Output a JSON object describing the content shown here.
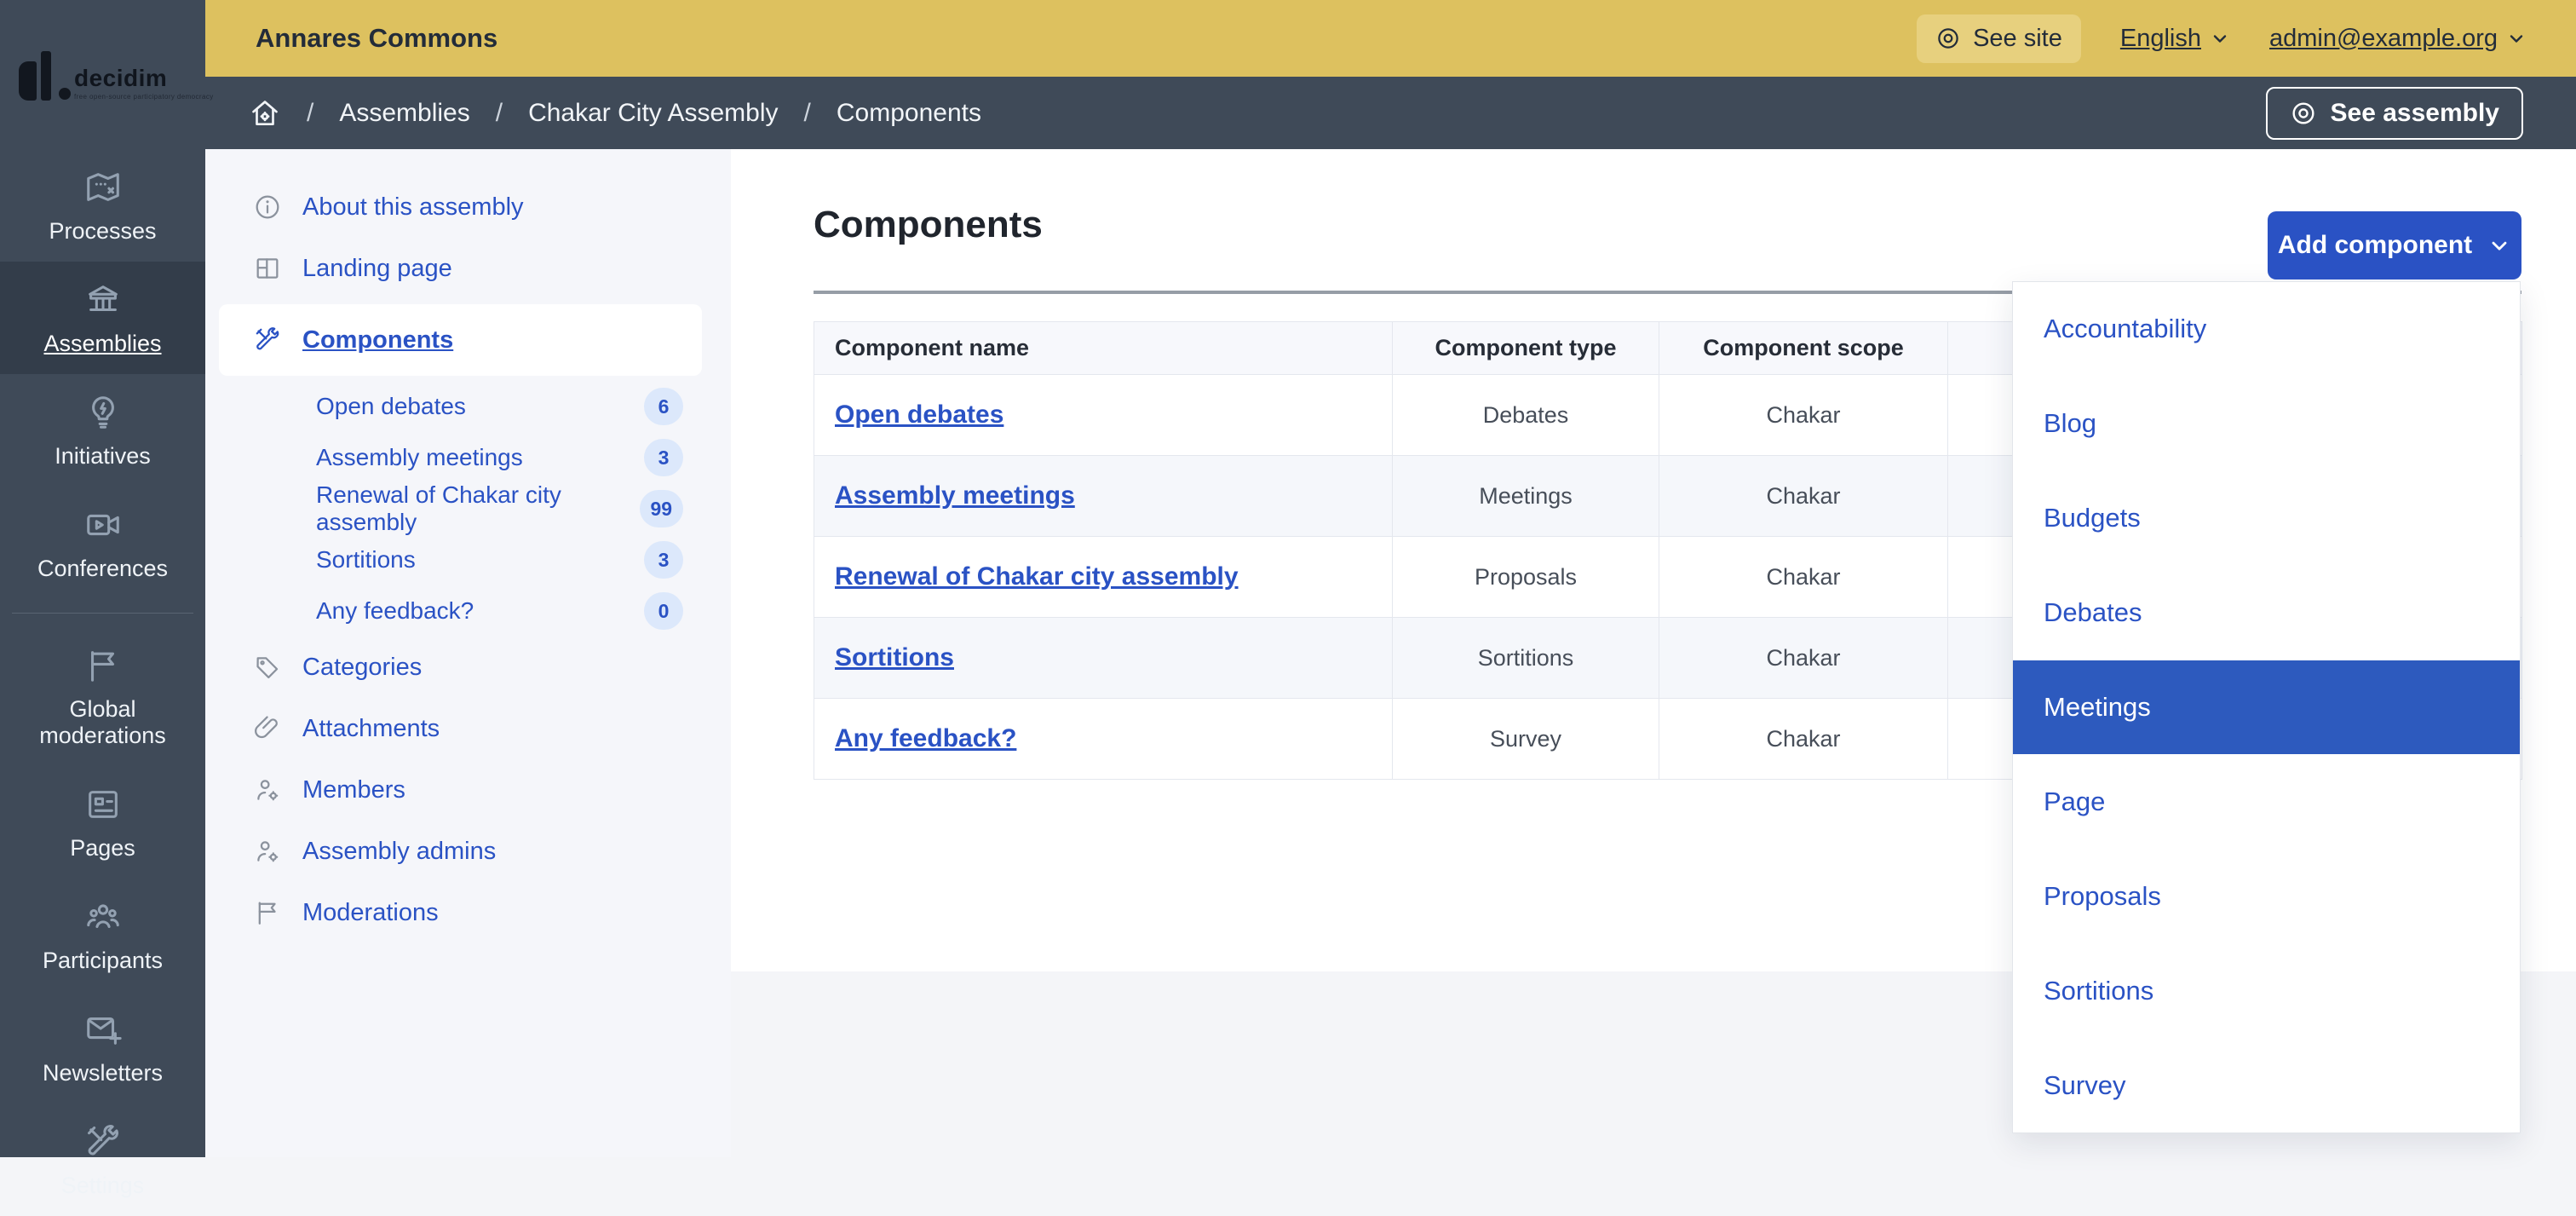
{
  "topbar": {
    "logo_text": "decidim",
    "logo_tagline": "free open-source participatory democracy",
    "title": "Annares Commons",
    "see_site": "See site",
    "language": "English",
    "account": "admin@example.org"
  },
  "breadcrumb": {
    "items": [
      "Assemblies",
      "Chakar City Assembly",
      "Components"
    ],
    "action": "See assembly"
  },
  "sidebar": {
    "items": [
      {
        "label": "Processes",
        "icon": "map-icon"
      },
      {
        "label": "Assemblies",
        "icon": "bank-icon",
        "active": true
      },
      {
        "label": "Initiatives",
        "icon": "lightbulb-icon"
      },
      {
        "label": "Conferences",
        "icon": "video-camera-icon"
      },
      {
        "label": "Global moderations",
        "icon": "flag-icon"
      },
      {
        "label": "Pages",
        "icon": "article-icon"
      },
      {
        "label": "Participants",
        "icon": "people-icon"
      },
      {
        "label": "Newsletters",
        "icon": "mail-plus-icon"
      },
      {
        "label": "Settings",
        "icon": "tools-icon"
      }
    ]
  },
  "secondary_nav": {
    "items_top": [
      {
        "label": "About this assembly",
        "icon": "info-icon"
      },
      {
        "label": "Landing page",
        "icon": "layout-icon"
      },
      {
        "label": "Components",
        "icon": "tools-icon",
        "active": true
      }
    ],
    "components_children": [
      {
        "label": "Open debates",
        "badge": "6"
      },
      {
        "label": "Assembly meetings",
        "badge": "3"
      },
      {
        "label": "Renewal of Chakar city assembly",
        "badge": "99"
      },
      {
        "label": "Sortitions",
        "badge": "3"
      },
      {
        "label": "Any feedback?",
        "badge": "0"
      }
    ],
    "items_after": [
      {
        "label": "Categories",
        "icon": "tag-icon"
      },
      {
        "label": "Attachments",
        "icon": "paperclip-icon"
      },
      {
        "label": "Members",
        "icon": "user-gear-icon"
      },
      {
        "label": "Assembly admins",
        "icon": "user-gear-icon"
      },
      {
        "label": "Moderations",
        "icon": "flag-icon"
      }
    ]
  },
  "main": {
    "title": "Components",
    "add_button": "Add component",
    "table": {
      "headers": [
        "Component name",
        "Component type",
        "Component scope"
      ],
      "rows": [
        {
          "name": "Open debates",
          "type": "Debates",
          "scope": "Chakar"
        },
        {
          "name": "Assembly meetings",
          "type": "Meetings",
          "scope": "Chakar"
        },
        {
          "name": "Renewal of Chakar city assembly",
          "type": "Proposals",
          "scope": "Chakar"
        },
        {
          "name": "Sortitions",
          "type": "Sortitions",
          "scope": "Chakar"
        },
        {
          "name": "Any feedback?",
          "type": "Survey",
          "scope": "Chakar"
        }
      ]
    }
  },
  "dropdown": {
    "items": [
      "Accountability",
      "Blog",
      "Budgets",
      "Debates",
      "Meetings",
      "Page",
      "Proposals",
      "Sortitions",
      "Survey"
    ],
    "selected": "Meetings"
  },
  "colors": {
    "yellow": "#ddc15f",
    "slate": "#3f4a58",
    "slate-active": "#333d4a",
    "blue": "#2a52c4",
    "highlight": "#2d5abe",
    "badge-bg": "#dce8fb",
    "page-bg": "#f4f5f8",
    "panel-bg": "#f5f6fa",
    "stripe": "#f5f7fb",
    "border": "#e4e7ee"
  }
}
